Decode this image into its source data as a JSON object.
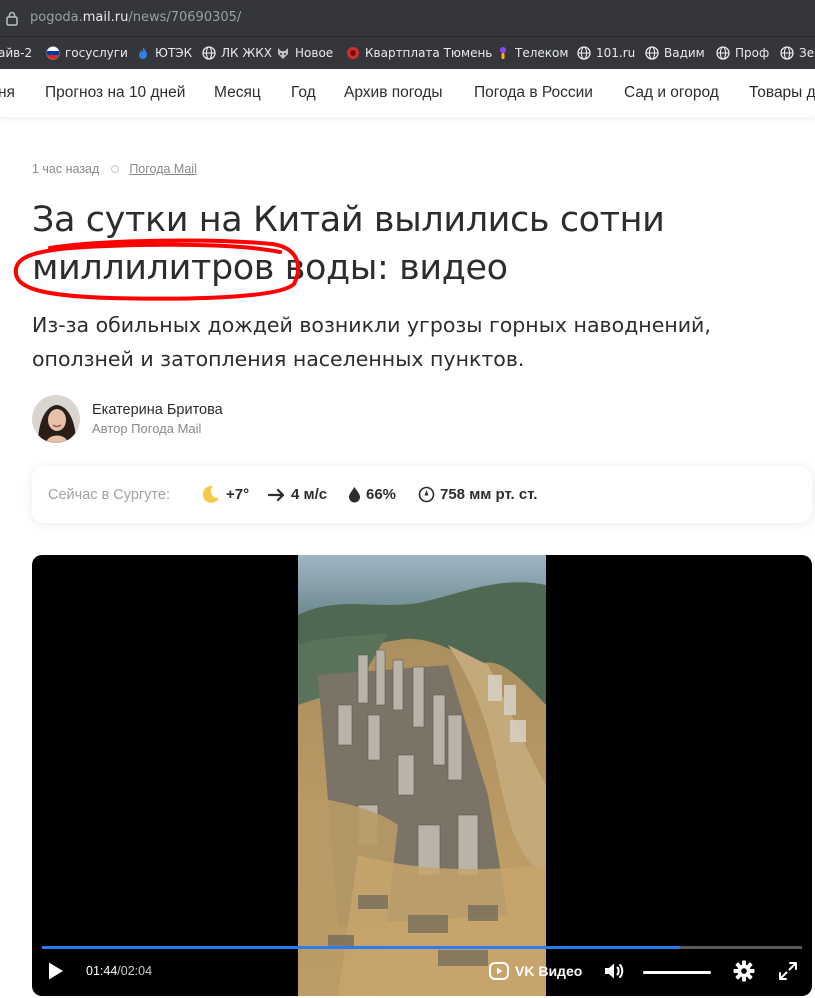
{
  "browser": {
    "url_prefix": "pogoda.",
    "url_domain": "mail.ru",
    "url_path": "/news/70690305/",
    "bookmarks": [
      {
        "label": "айв-2",
        "icon": "bookmark-icon"
      },
      {
        "label": "госуслуги",
        "icon": "gosuslugi-icon"
      },
      {
        "label": "ЮТЭК",
        "icon": "flame-icon"
      },
      {
        "label": "ЛК ЖКХ",
        "icon": "globe-icon"
      },
      {
        "label": "Новое",
        "icon": "fox-icon"
      },
      {
        "label": "Квартплата Тюмень",
        "icon": "red-circle-icon"
      },
      {
        "label": "Телеком",
        "icon": "telecom-icon"
      },
      {
        "label": "101.ru",
        "icon": "globe-icon"
      },
      {
        "label": "Вадим",
        "icon": "globe-icon"
      },
      {
        "label": "Проф",
        "icon": "globe-icon"
      },
      {
        "label": "Зе",
        "icon": "globe-icon"
      }
    ]
  },
  "nav": {
    "items": [
      "ня",
      "Прогноз на 10 дней",
      "Месяц",
      "Год",
      "Архив погоды",
      "Погода в России",
      "Сад и огород",
      "Товары д"
    ]
  },
  "article": {
    "time_ago": "1 час назад",
    "source": "Погода Mail",
    "title_line1": "За сутки на Китай вылились сотни",
    "title_line2": "миллилитров воды: видео",
    "lead_line1": "Из-за обильных дождей возникли угрозы горных наводнений,",
    "lead_line2": "оползней и затопления населенных пунктов.",
    "author_name": "Екатерина Бритова",
    "author_role": "Автор Погода Mail"
  },
  "weather": {
    "label": "Сейчас в Сургуте:",
    "temp": "+7°",
    "wind": "4 м/с",
    "humidity": "66%",
    "pressure": "758 мм рт. ст."
  },
  "video": {
    "current_time": "01:44",
    "separator": " / ",
    "duration": "02:04",
    "progress_fraction": 0.84,
    "volume_fraction": 1.0,
    "brand": "VK Видео"
  },
  "colors": {
    "accent_blue": "#2b7cf1",
    "annotation_red": "#ff0000",
    "text": "#2c2d2e",
    "muted": "#87898f"
  }
}
